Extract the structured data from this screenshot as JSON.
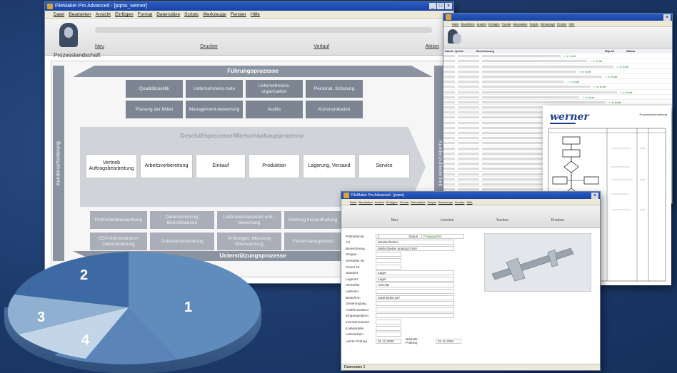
{
  "main_window": {
    "title": "FileMaker Pro Advanced - [pqms_werner]",
    "menu": [
      "Datei",
      "Bearbeiten",
      "Ansicht",
      "Einfügen",
      "Format",
      "Datensätze",
      "Scripts",
      "Werkzeuge",
      "Fenster",
      "Hilfe"
    ],
    "nav": [
      "Neu",
      "Drucker",
      "Verlauf",
      "Aktion"
    ],
    "section_title": "Prozesslandschaft",
    "band_top": "Führungsprozesse",
    "band_bottom": "Unterstützungsprozesse",
    "vband_left": "Kundenanforderung",
    "vband_right": "Kundenzufriedenheit",
    "fuehrung_row1": [
      "Qualitätspolitik",
      "Unternehmens-ziele",
      "Unternehmens-organisation",
      "Personal, Schulung"
    ],
    "fuehrung_row2": [
      "Planung der Mittel",
      "Management-bewertung",
      "Audits",
      "Kommunikation"
    ],
    "wertschoepfung_title": "Geschäftsprozesse/Wertschöpfungsprozesse",
    "wertschoepfung": [
      "Vertrieb Auftragsbearbeitung",
      "Arbeitsvorbereitung",
      "Einkauf",
      "Produktion",
      "Lagerung, Versand",
      "Service"
    ],
    "unterstuetzung_row1": [
      "Prüfmittelüberwachung",
      "Datensicherung, Berichtswesen",
      "Lieferantenauswahl und -bewertung",
      "Wartung Instandhaltung"
    ],
    "unterstuetzung_row2": [
      "EDV-Administration Datensicherung",
      "Dokumentenlenkung",
      "Prüfungen, Messung Überwachung",
      "Fehlermanagement"
    ]
  },
  "list_window": {
    "menu": [
      "Datei",
      "Bearbeiten",
      "Ansicht",
      "Einfügen",
      "Format",
      "Datensätze",
      "Scripts",
      "Werkzeuge",
      "Fenster",
      "Hilfe"
    ],
    "columns": [
      "Datum",
      "Quelle",
      "Bezeichnung",
      "Bsp-Nr",
      "Status"
    ],
    "rows": 28,
    "status_value": "in Kraft"
  },
  "document": {
    "logo": "werner",
    "header_right": "Prozessbeschreibung"
  },
  "form_window": {
    "title": "FileMaker Pro Advanced - [pqms]",
    "nav": [
      "Neu",
      "Löschen",
      "Suchen",
      "Drucken"
    ],
    "fields": [
      {
        "label": "Prüfmittel-Nr.",
        "value": "1"
      },
      {
        "label": "Art",
        "value": "Messschieber"
      },
      {
        "label": "Bezeichnung",
        "value": "Meßschieber analog 0-150"
      },
      {
        "label": "Gruppe",
        "value": ""
      },
      {
        "label": "Hersteller Nr.",
        "value": ""
      },
      {
        "label": "Serien Nr.",
        "value": ""
      },
      {
        "label": "Standort",
        "value": "Lager"
      },
      {
        "label": "Lagerort",
        "value": "Lager"
      },
      {
        "label": "Hersteller",
        "value": "ASCHE"
      },
      {
        "label": "Lieferant",
        "value": ""
      },
      {
        "label": "Bestell Nr.",
        "value": "1000-5156-167"
      },
      {
        "label": "Genehmigung",
        "value": ""
      },
      {
        "label": "Anlieferzustand",
        "value": ""
      },
      {
        "label": "Eingangsdatum",
        "value": ""
      },
      {
        "label": "Inventarnummer",
        "value": ""
      },
      {
        "label": "Kostenstelle",
        "value": ""
      },
      {
        "label": "Lieferschein",
        "value": ""
      }
    ],
    "status_label": "Status",
    "status_value": "Freigegeben",
    "last_check_label": "Letzte Prüfung",
    "last_check_value": "01.11.2000",
    "next_check_label": "Nächste Prüfung",
    "next_check_value": "01.11.2004",
    "statusbar": "Datensätze 1"
  },
  "pie": {
    "labels": [
      "1",
      "2",
      "3",
      "4"
    ],
    "colors": [
      "#5b85b8",
      "#3e6aa3",
      "#8fb0d0",
      "#c2d6e8"
    ]
  }
}
